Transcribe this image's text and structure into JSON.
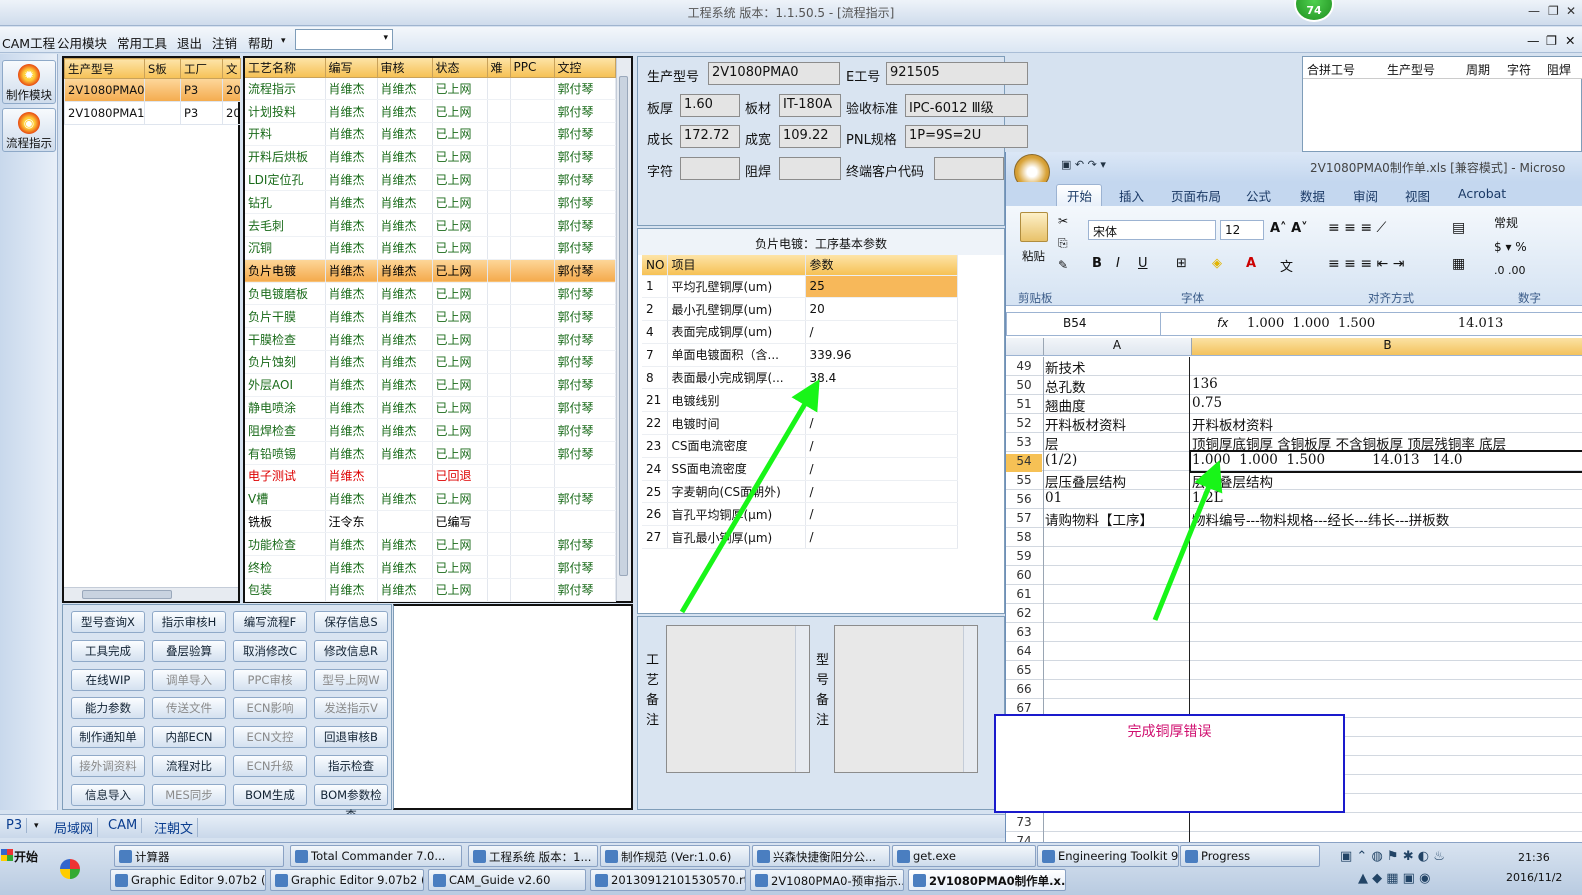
{
  "window": {
    "title": "工程系统  版本：1.1.50.5 - [流程指示]",
    "badge": "74",
    "min": "—",
    "restore": "❐",
    "close": "✕"
  },
  "menu": {
    "items": [
      "CAM工程",
      "公用模块",
      "常用工具",
      "退出",
      "注销",
      "帮助"
    ],
    "caret": "▾"
  },
  "sidebar": {
    "items": [
      "制作模块",
      "流程指示"
    ]
  },
  "orders": {
    "headers": [
      "生产型号",
      "S板",
      "工厂",
      "文"
    ],
    "rows": [
      [
        "2V1080PMA0",
        "",
        "P3",
        "20"
      ],
      [
        "2V1080PMA1",
        "",
        "P3",
        "20"
      ]
    ]
  },
  "process": {
    "headers": [
      "工艺名称",
      "编写",
      "审核",
      "状态",
      "难",
      "PPC",
      "文控"
    ],
    "rows": [
      [
        "流程指示",
        "肖维杰",
        "肖维杰",
        "已上网",
        "",
        "",
        "郭付琴",
        ""
      ],
      [
        "计划投料",
        "肖维杰",
        "肖维杰",
        "已上网",
        "",
        "",
        "郭付琴",
        ""
      ],
      [
        "开料",
        "肖维杰",
        "肖维杰",
        "已上网",
        "",
        "",
        "郭付琴",
        ""
      ],
      [
        "开料后烘板",
        "肖维杰",
        "肖维杰",
        "已上网",
        "",
        "",
        "郭付琴",
        ""
      ],
      [
        "LDI定位孔",
        "肖维杰",
        "肖维杰",
        "已上网",
        "",
        "",
        "郭付琴",
        ""
      ],
      [
        "钻孔",
        "肖维杰",
        "肖维杰",
        "已上网",
        "",
        "",
        "郭付琴",
        ""
      ],
      [
        "去毛刺",
        "肖维杰",
        "肖维杰",
        "已上网",
        "",
        "",
        "郭付琴",
        ""
      ],
      [
        "沉铜",
        "肖维杰",
        "肖维杰",
        "已上网",
        "",
        "",
        "郭付琴",
        ""
      ],
      [
        "负片电镀",
        "肖维杰",
        "肖维杰",
        "已上网",
        "",
        "",
        "郭付琴",
        "sel"
      ],
      [
        "负电镀磨板",
        "肖维杰",
        "肖维杰",
        "已上网",
        "",
        "",
        "郭付琴",
        ""
      ],
      [
        "负片干膜",
        "肖维杰",
        "肖维杰",
        "已上网",
        "",
        "",
        "郭付琴",
        ""
      ],
      [
        "干膜检查",
        "肖维杰",
        "肖维杰",
        "已上网",
        "",
        "",
        "郭付琴",
        ""
      ],
      [
        "负片蚀刻",
        "肖维杰",
        "肖维杰",
        "已上网",
        "",
        "",
        "郭付琴",
        ""
      ],
      [
        "外层AOI",
        "肖维杰",
        "肖维杰",
        "已上网",
        "",
        "",
        "郭付琴",
        ""
      ],
      [
        "静电喷涂",
        "肖维杰",
        "肖维杰",
        "已上网",
        "",
        "",
        "郭付琴",
        ""
      ],
      [
        "阻焊检查",
        "肖维杰",
        "肖维杰",
        "已上网",
        "",
        "",
        "郭付琴",
        ""
      ],
      [
        "有铅喷锡",
        "肖维杰",
        "肖维杰",
        "已上网",
        "",
        "",
        "郭付琴",
        ""
      ],
      [
        "电子测试",
        "肖维杰",
        "",
        "已回退",
        "",
        "",
        "",
        "red"
      ],
      [
        "V槽",
        "肖维杰",
        "肖维杰",
        "已上网",
        "",
        "",
        "郭付琴",
        ""
      ],
      [
        "铣板",
        "汪令东",
        "",
        "已编写",
        "",
        "",
        "",
        "blk"
      ],
      [
        "功能检查",
        "肖维杰",
        "肖维杰",
        "已上网",
        "",
        "",
        "郭付琴",
        ""
      ],
      [
        "终检",
        "肖维杰",
        "肖维杰",
        "已上网",
        "",
        "",
        "郭付琴",
        ""
      ],
      [
        "包装",
        "肖维杰",
        "肖维杰",
        "已上网",
        "",
        "",
        "郭付琴",
        ""
      ]
    ]
  },
  "buttons": [
    [
      {
        "l": "型号查询X",
        "d": false
      },
      {
        "l": "指示审核H",
        "d": false
      },
      {
        "l": "编写流程F",
        "d": false
      },
      {
        "l": "保存信息S",
        "d": false
      }
    ],
    [
      {
        "l": "工具完成",
        "d": false
      },
      {
        "l": "叠层验算",
        "d": false
      },
      {
        "l": "取消修改C",
        "d": false
      },
      {
        "l": "修改信息R",
        "d": false
      }
    ],
    [
      {
        "l": "在线WIP",
        "d": false
      },
      {
        "l": "调单导入",
        "d": true
      },
      {
        "l": "PPC审核",
        "d": true
      },
      {
        "l": "型号上网W",
        "d": true
      }
    ],
    [
      {
        "l": "能力参数",
        "d": false
      },
      {
        "l": "传送文件",
        "d": true
      },
      {
        "l": "ECN影响",
        "d": true
      },
      {
        "l": "发送指示V",
        "d": true
      }
    ],
    [
      {
        "l": "制作通知单",
        "d": false
      },
      {
        "l": "内部ECN",
        "d": false
      },
      {
        "l": "ECN文控",
        "d": true
      },
      {
        "l": "回退审核B",
        "d": false
      }
    ],
    [
      {
        "l": "接外调资料",
        "d": true
      },
      {
        "l": "流程对比",
        "d": false
      },
      {
        "l": "ECN升级",
        "d": true
      },
      {
        "l": "指示检查",
        "d": false
      }
    ],
    [
      {
        "l": "信息导入",
        "d": false
      },
      {
        "l": "MES同步",
        "d": true
      },
      {
        "l": "BOM生成",
        "d": false
      },
      {
        "l": "BOM参数检查",
        "d": false
      }
    ]
  ],
  "info": {
    "model_label": "生产型号",
    "model": "2V1080PMA0",
    "eno_label": "E工号",
    "eno": "921505",
    "thick_label": "板厚",
    "thick": "1.60",
    "mat_label": "板材",
    "mat": "IT-180A",
    "std_label": "验收标准",
    "std": "IPC-6012 Ⅲ级",
    "len_label": "成长",
    "len": "172.72",
    "wid_label": "成宽",
    "wid": "109.22",
    "pnl_label": "PNL规格",
    "pnl": "1P=9S=2U",
    "char_label": "字符",
    "char": "",
    "mask_label": "阻焊",
    "mask": "",
    "cust_label": "终端客户代码",
    "cust": ""
  },
  "params": {
    "title": "负片电镀：工序基本参数",
    "headers": [
      "NO",
      "项目",
      "参数"
    ],
    "rows": [
      [
        "1",
        "平均孔壁铜厚(um)",
        "25"
      ],
      [
        "2",
        "最小孔壁铜厚(um)",
        "20"
      ],
      [
        "4",
        "表面完成铜厚(um)",
        "/"
      ],
      [
        "7",
        "单面电镀面积（含...",
        "339.96"
      ],
      [
        "8",
        "表面最小完成铜厚(...",
        "38.4"
      ],
      [
        "21",
        "电镀线别",
        ""
      ],
      [
        "22",
        "电镀时间",
        "/"
      ],
      [
        "23",
        "CS面电流密度",
        "/"
      ],
      [
        "24",
        "SS面电流密度",
        "/"
      ],
      [
        "25",
        "字麦朝向(CS面朝外)",
        "/"
      ],
      [
        "26",
        "盲孔平均铜厚(μm)",
        "/"
      ],
      [
        "27",
        "盲孔最小铜厚(μm)",
        "/"
      ]
    ]
  },
  "remarks": {
    "process_label": "工艺备注",
    "model_label": "型号备注"
  },
  "merge": {
    "headers": [
      "合拼工号",
      "生产型号",
      "周期",
      "字符",
      "阻焊"
    ]
  },
  "excel": {
    "title": "2V1080PMA0制作单.xls [兼容模式] - Microso",
    "tabs": [
      "开始",
      "插入",
      "页面布局",
      "公式",
      "数据",
      "审阅",
      "视图",
      "Acrobat"
    ],
    "font": "宋体",
    "size": "12",
    "numfmt": "常规",
    "paste": "粘贴",
    "groups": [
      "剪贴板",
      "字体",
      "对齐方式",
      "数字"
    ],
    "cellref": "B54",
    "formula": "1.000  1.000  1.500                    14.013",
    "cols": [
      "A",
      "B"
    ],
    "rows": [
      [
        "49",
        "新技术",
        ""
      ],
      [
        "50",
        "总孔数",
        "136"
      ],
      [
        "51",
        "翘曲度",
        "0.75"
      ],
      [
        "52",
        "开料板材资料",
        "开料板材资料"
      ],
      [
        "53",
        "层",
        "顶铜厚底铜厚 含铜板厚 不含铜板厚 顶层残铜率 底层"
      ],
      [
        "54",
        "(1/2)",
        "1.000  1.000  1.500           14.013   14.0"
      ],
      [
        "55",
        "层压叠层结构",
        "层压叠层结构"
      ],
      [
        "56",
        "01",
        "1/2L"
      ],
      [
        "57",
        "请购物料【工序】",
        "物料编号---物料规格---经长---纬长---拼板数"
      ],
      [
        "58",
        "",
        ""
      ],
      [
        "59",
        "",
        ""
      ],
      [
        "60",
        "",
        ""
      ],
      [
        "61",
        "",
        ""
      ],
      [
        "62",
        "",
        ""
      ],
      [
        "63",
        "",
        ""
      ],
      [
        "64",
        "",
        ""
      ],
      [
        "65",
        "",
        ""
      ],
      [
        "66",
        "",
        ""
      ],
      [
        "67",
        "",
        ""
      ],
      [
        "68",
        "",
        ""
      ],
      [
        "69",
        "",
        ""
      ],
      [
        "70",
        "",
        ""
      ],
      [
        "71",
        "",
        ""
      ],
      [
        "72",
        "",
        ""
      ],
      [
        "73",
        "",
        ""
      ],
      [
        "74",
        "",
        ""
      ]
    ]
  },
  "note": "完成铜厚错误",
  "status": {
    "plant": "P3",
    "tabs": [
      "局域网",
      "CAM",
      "汪朝文"
    ]
  },
  "taskbar": {
    "start": "开始",
    "row1": [
      "计算器",
      "Total Commander 7.0...",
      "工程系统  版本：1...",
      "制作规范 (Ver:1.0.6)",
      "兴森快捷衡阳分公...",
      "get.exe",
      "Engineering Toolkit 9....",
      "Progress"
    ],
    "row2": [
      "Graphic Editor 9.07b2 (0...",
      "Graphic Editor 9.07b2 (0...",
      "CAM_Guide v2.60",
      "20130912101530570.rtf...",
      "2V1080PMA0-预审指示...",
      "2V1080PMA0制作单.x..."
    ],
    "time": "21:36",
    "date": "2016/11/2"
  }
}
